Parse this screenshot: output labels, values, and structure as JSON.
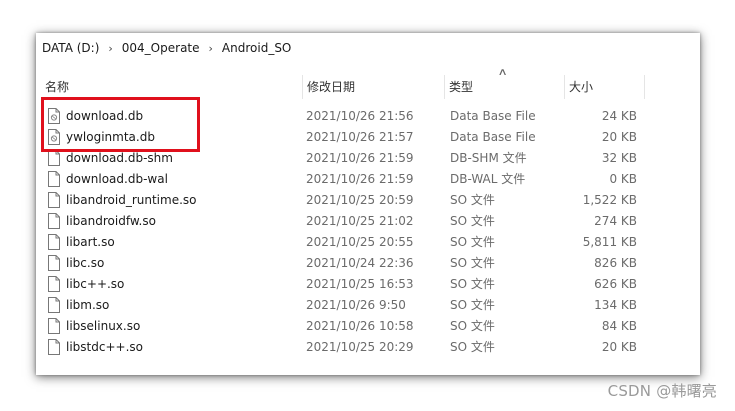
{
  "breadcrumb": [
    "DATA (D:)",
    "004_Operate",
    "Android_SO"
  ],
  "columns": {
    "name": "名称",
    "date": "修改日期",
    "type": "类型",
    "size": "大小"
  },
  "files": [
    {
      "name": "download.db",
      "date": "2021/10/26 21:56",
      "type": "Data Base File",
      "size": "24 KB",
      "icon": "db-file-icon"
    },
    {
      "name": "ywloginmta.db",
      "date": "2021/10/26 21:57",
      "type": "Data Base File",
      "size": "20 KB",
      "icon": "db-file-icon"
    },
    {
      "name": "download.db-shm",
      "date": "2021/10/26 21:59",
      "type": "DB-SHM 文件",
      "size": "32 KB",
      "icon": "blank-file-icon"
    },
    {
      "name": "download.db-wal",
      "date": "2021/10/26 21:59",
      "type": "DB-WAL 文件",
      "size": "0 KB",
      "icon": "blank-file-icon"
    },
    {
      "name": "libandroid_runtime.so",
      "date": "2021/10/25 20:59",
      "type": "SO 文件",
      "size": "1,522 KB",
      "icon": "blank-file-icon"
    },
    {
      "name": "libandroidfw.so",
      "date": "2021/10/25 21:02",
      "type": "SO 文件",
      "size": "274 KB",
      "icon": "blank-file-icon"
    },
    {
      "name": "libart.so",
      "date": "2021/10/25 20:55",
      "type": "SO 文件",
      "size": "5,811 KB",
      "icon": "blank-file-icon"
    },
    {
      "name": "libc.so",
      "date": "2021/10/24 22:36",
      "type": "SO 文件",
      "size": "826 KB",
      "icon": "blank-file-icon"
    },
    {
      "name": "libc++.so",
      "date": "2021/10/25 16:53",
      "type": "SO 文件",
      "size": "626 KB",
      "icon": "blank-file-icon"
    },
    {
      "name": "libm.so",
      "date": "2021/10/26 9:50",
      "type": "SO 文件",
      "size": "134 KB",
      "icon": "blank-file-icon"
    },
    {
      "name": "libselinux.so",
      "date": "2021/10/26 10:58",
      "type": "SO 文件",
      "size": "84 KB",
      "icon": "blank-file-icon"
    },
    {
      "name": "libstdc++.so",
      "date": "2021/10/25 20:29",
      "type": "SO 文件",
      "size": "20 KB",
      "icon": "blank-file-icon"
    }
  ],
  "highlight_color": "#e0101c",
  "watermark": "CSDN @韩曙亮"
}
